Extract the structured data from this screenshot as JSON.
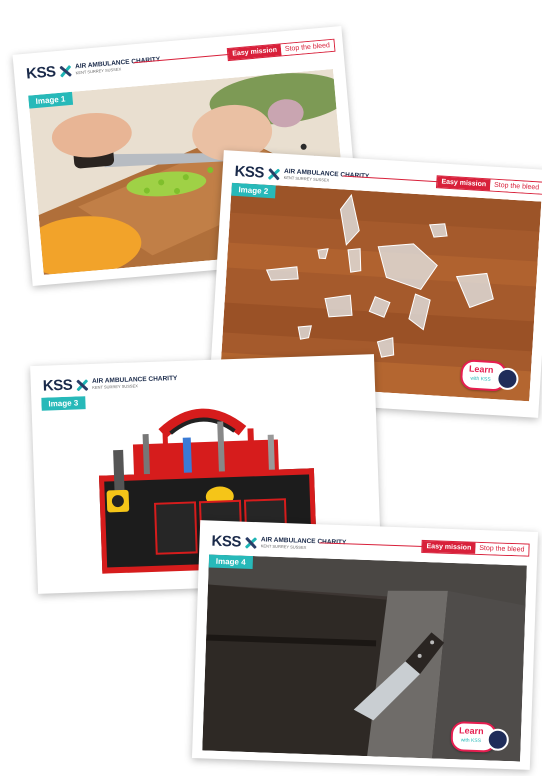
{
  "brand": {
    "logo_mark": "KSS",
    "logo_line1": "AIR AMBULANCE CHARITY",
    "logo_line2": "KENT SURREY SUSSEX",
    "mission_label": "Easy mission",
    "mission_title": "Stop the bleed",
    "badge_text1": "Learn",
    "badge_text2": "with KSS",
    "accent_red": "#d8203a",
    "accent_teal": "#27b9b9",
    "icons": [
      "kss-cross-icon",
      "learn-badge-icon"
    ]
  },
  "cards": [
    {
      "label": "Image 1"
    },
    {
      "label": "Image 2"
    },
    {
      "label": "Image 3"
    },
    {
      "label": "Image 4"
    }
  ]
}
